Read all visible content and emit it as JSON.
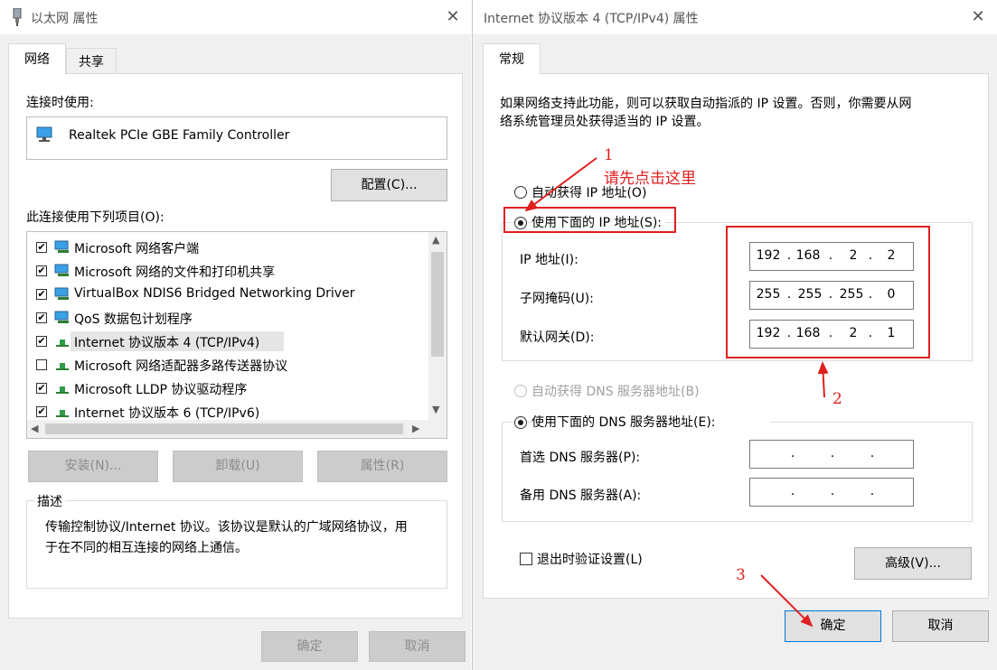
{
  "left_window": {
    "title": "以太网 属性",
    "tabs": [
      "网络",
      "共享"
    ],
    "connect_using_label": "连接时使用:",
    "adapter_name": "Realtek PCIe GBE Family Controller",
    "configure_button": "配置(C)...",
    "items_label": "此连接使用下列项目(O):",
    "items": [
      {
        "label": "Microsoft 网络客户端",
        "checked": true
      },
      {
        "label": "Microsoft 网络的文件和打印机共享",
        "checked": true
      },
      {
        "label": "VirtualBox NDIS6 Bridged Networking Driver",
        "checked": true
      },
      {
        "label": "QoS 数据包计划程序",
        "checked": true
      },
      {
        "label": "Internet 协议版本 4 (TCP/IPv4)",
        "checked": true,
        "selected": true
      },
      {
        "label": "Microsoft 网络适配器多路传送器协议",
        "checked": false
      },
      {
        "label": "Microsoft LLDP 协议驱动程序",
        "checked": true
      },
      {
        "label": "Internet 协议版本 6 (TCP/IPv6)",
        "checked": true
      }
    ],
    "install_button": "安装(N)...",
    "uninstall_button": "卸载(U)",
    "properties_button": "属性(R)",
    "description_label": "描述",
    "description_text_line1": "传输控制协议/Internet 协议。该协议是默认的广域网络协议，用",
    "description_text_line2": "于在不同的相互连接的网络上通信。",
    "ok_button": "确定",
    "cancel_button": "取消"
  },
  "right_window": {
    "title": "Internet 协议版本 4 (TCP/IPv4) 属性",
    "tab": "常规",
    "intro_line1": "如果网络支持此功能，则可以获取自动指派的 IP 设置。否则，你需要从网",
    "intro_line2": "络系统管理员处获得适当的 IP 设置。",
    "auto_ip_option": "自动获得 IP 地址(O)",
    "manual_ip_option": "使用下面的 IP 地址(S):",
    "ip_label": "IP 地址(I):",
    "ip_address": [
      "192",
      "168",
      "2",
      "2"
    ],
    "subnet_label": "子网掩码(U):",
    "subnet_mask": [
      "255",
      "255",
      "255",
      "0"
    ],
    "gateway_label": "默认网关(D):",
    "default_gateway": [
      "192",
      "168",
      "2",
      "1"
    ],
    "auto_dns_option": "自动获得 DNS 服务器地址(B)",
    "manual_dns_option": "使用下面的 DNS 服务器地址(E):",
    "preferred_dns_label": "首选 DNS 服务器(P):",
    "alternate_dns_label": "备用 DNS 服务器(A):",
    "validate_on_exit": "退出时验证设置(L)",
    "advanced_button": "高级(V)...",
    "ok_button": "确定",
    "cancel_button": "取消"
  },
  "annotations": {
    "step1_number": "1",
    "step1_text": "请先点击这里",
    "step2_number": "2",
    "step3_number": "3"
  },
  "colors": {
    "annotation_red": "#e02020",
    "selection_bg": "#e5e5e5"
  }
}
